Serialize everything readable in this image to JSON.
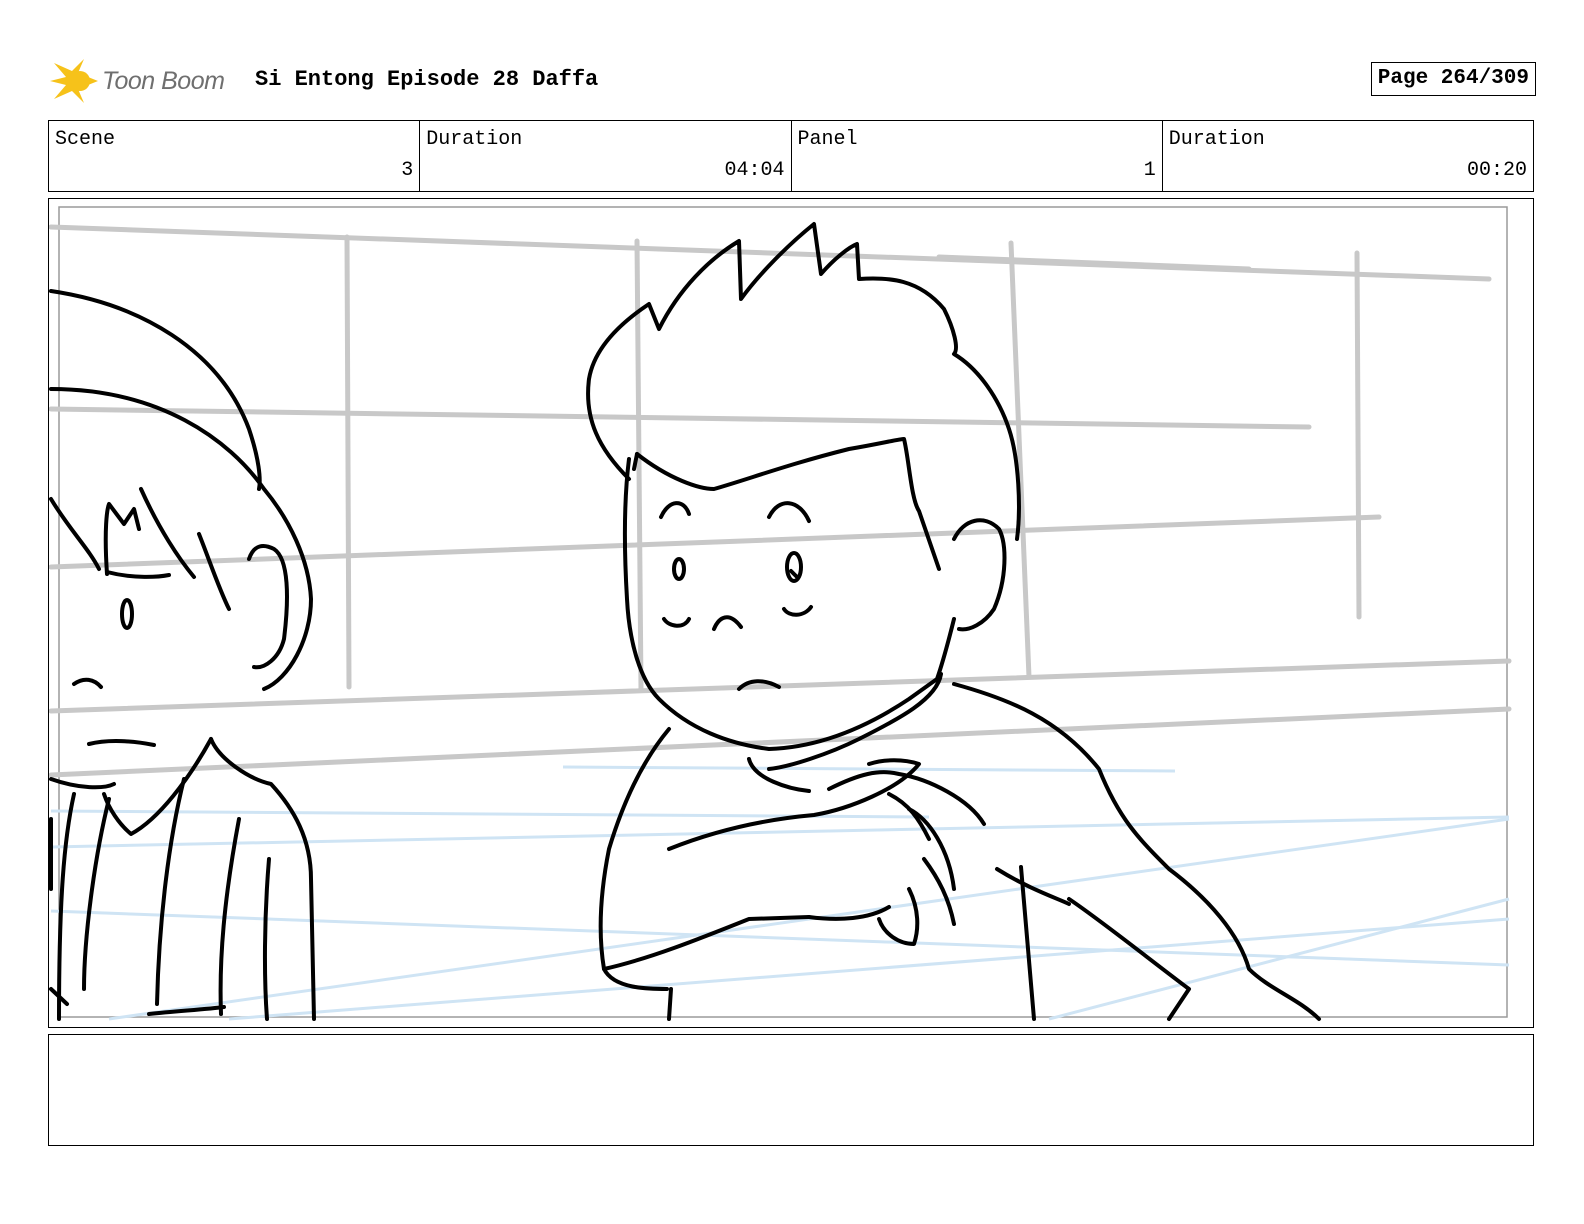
{
  "header": {
    "logo_text": "Toon Boom",
    "title": "Si Entong Episode 28 Daffa",
    "page": "Page 264/309"
  },
  "info": [
    {
      "label": "Scene",
      "value": "3"
    },
    {
      "label": "Duration",
      "value": "04:04"
    },
    {
      "label": "Panel",
      "value": "1"
    },
    {
      "label": "Duration",
      "value": "00:20"
    }
  ],
  "panel": {
    "icon": "storyboard-sketch-image"
  },
  "notes": {
    "text": ""
  },
  "colors": {
    "logo_burst": "#f6c21a",
    "logo_text": "#6f6f6f",
    "guide_gray": "#c8c8c8",
    "guide_blue": "#cfe4f4",
    "ink": "#000000"
  }
}
